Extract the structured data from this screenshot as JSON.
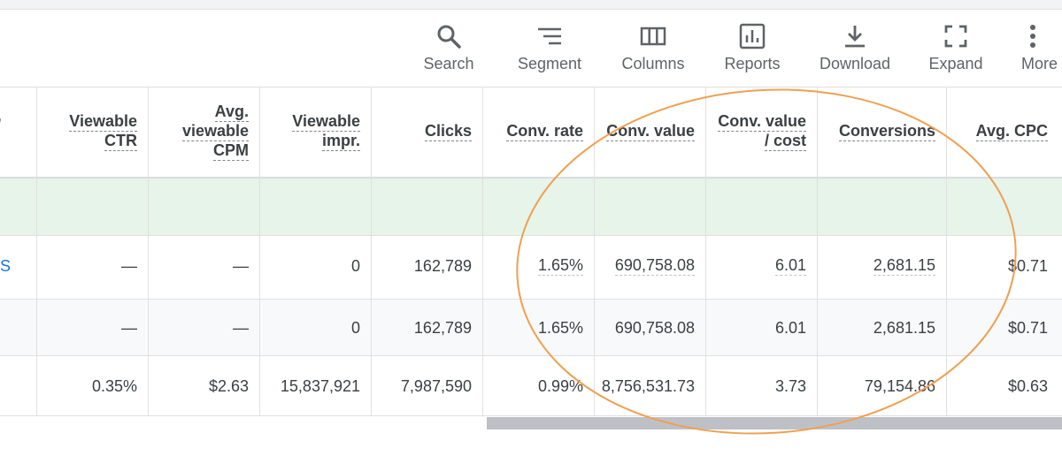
{
  "toolbar": {
    "search_label": "Search",
    "segment_label": "Segment",
    "columns_label": "Columns",
    "reports_label": "Reports",
    "download_label": "Download",
    "expand_label": "Expand",
    "more_label": "More"
  },
  "table": {
    "partial_header_glyph": "/",
    "headers": {
      "viewable_ctr": [
        "Viewable",
        "CTR"
      ],
      "avg_viewable_cpm": [
        "Avg.",
        "viewable",
        "CPM"
      ],
      "viewable_impr": [
        "Viewable",
        "impr."
      ],
      "clicks": [
        "Clicks"
      ],
      "conv_rate": [
        "Conv. rate"
      ],
      "conv_value": [
        "Conv. value"
      ],
      "conv_value_cost": [
        "Conv. value",
        "/ cost"
      ],
      "conversions": [
        "Conversions"
      ],
      "avg_cpc": [
        "Avg. CPC"
      ]
    },
    "rows": [
      {
        "lead": "S",
        "viewable_ctr": "—",
        "avg_viewable_cpm": "—",
        "viewable_impr": "0",
        "clicks": "162,789",
        "conv_rate": "1.65%",
        "conv_value": "690,758.08",
        "conv_value_cost": "6.01",
        "conversions": "2,681.15",
        "avg_cpc": "$0.71"
      },
      {
        "lead": "",
        "viewable_ctr": "—",
        "avg_viewable_cpm": "—",
        "viewable_impr": "0",
        "clicks": "162,789",
        "conv_rate": "1.65%",
        "conv_value": "690,758.08",
        "conv_value_cost": "6.01",
        "conversions": "2,681.15",
        "avg_cpc": "$0.71"
      },
      {
        "lead": "",
        "viewable_ctr": "0.35%",
        "avg_viewable_cpm": "$2.63",
        "viewable_impr": "15,837,921",
        "clicks": "7,987,590",
        "conv_rate": "0.99%",
        "conv_value": "8,756,531.73",
        "conv_value_cost": "3.73",
        "conversions": "79,154.86",
        "avg_cpc": "$0.63"
      }
    ]
  },
  "colors": {
    "accent_link": "#1a73e8",
    "highlight_row": "#e6f4ea",
    "annotation_ellipse": "#f0a050"
  },
  "icons": [
    "search-icon",
    "segment-icon",
    "columns-icon",
    "reports-icon",
    "download-icon",
    "expand-icon",
    "more-icon"
  ]
}
